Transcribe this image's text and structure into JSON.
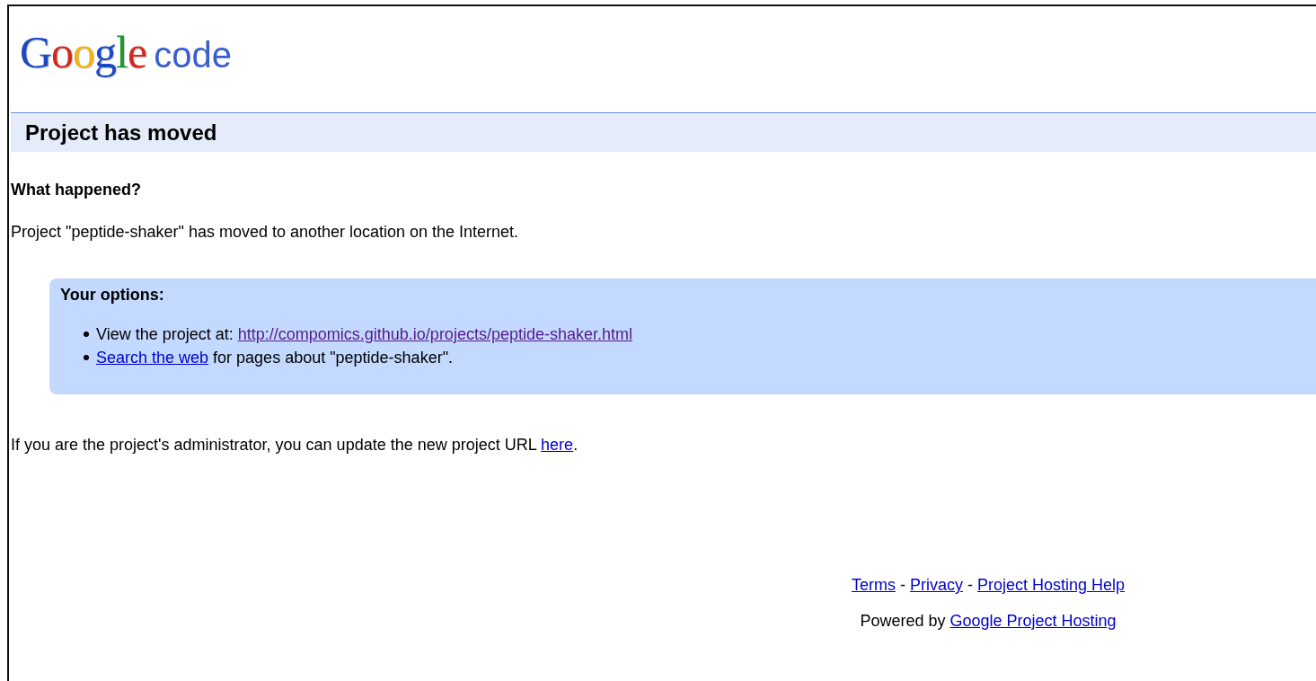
{
  "logo": {
    "brand": "Google",
    "product": "code"
  },
  "title_bar": {
    "title": "Project has moved"
  },
  "section_heading": "What happened?",
  "message": "Project \"peptide-shaker\" has moved to another location on the Internet.",
  "options": {
    "title": "Your options:",
    "items": [
      [
        {
          "kind": "text",
          "text": "View the project at: "
        },
        {
          "kind": "link",
          "text": "http://compomics.github.io/projects/peptide-shaker.html",
          "visited": true
        }
      ],
      [
        {
          "kind": "link",
          "text": "Search the web",
          "visited": false
        },
        {
          "kind": "text",
          "text": " for pages about \"peptide-shaker\"."
        }
      ]
    ]
  },
  "admin_note": [
    {
      "kind": "text",
      "text": "If you are the project's administrator, you can update the new project URL "
    },
    {
      "kind": "link",
      "text": "here",
      "visited": false
    },
    {
      "kind": "text",
      "text": "."
    }
  ],
  "footer": {
    "links_line": [
      {
        "kind": "link",
        "text": "Terms",
        "visited": false
      },
      {
        "kind": "text",
        "text": " - "
      },
      {
        "kind": "link",
        "text": "Privacy",
        "visited": false
      },
      {
        "kind": "text",
        "text": " - "
      },
      {
        "kind": "link",
        "text": "Project Hosting Help",
        "visited": false
      }
    ],
    "powered_line": [
      {
        "kind": "text",
        "text": "Powered by "
      },
      {
        "kind": "link",
        "text": "Google Project Hosting",
        "visited": false
      }
    ]
  }
}
